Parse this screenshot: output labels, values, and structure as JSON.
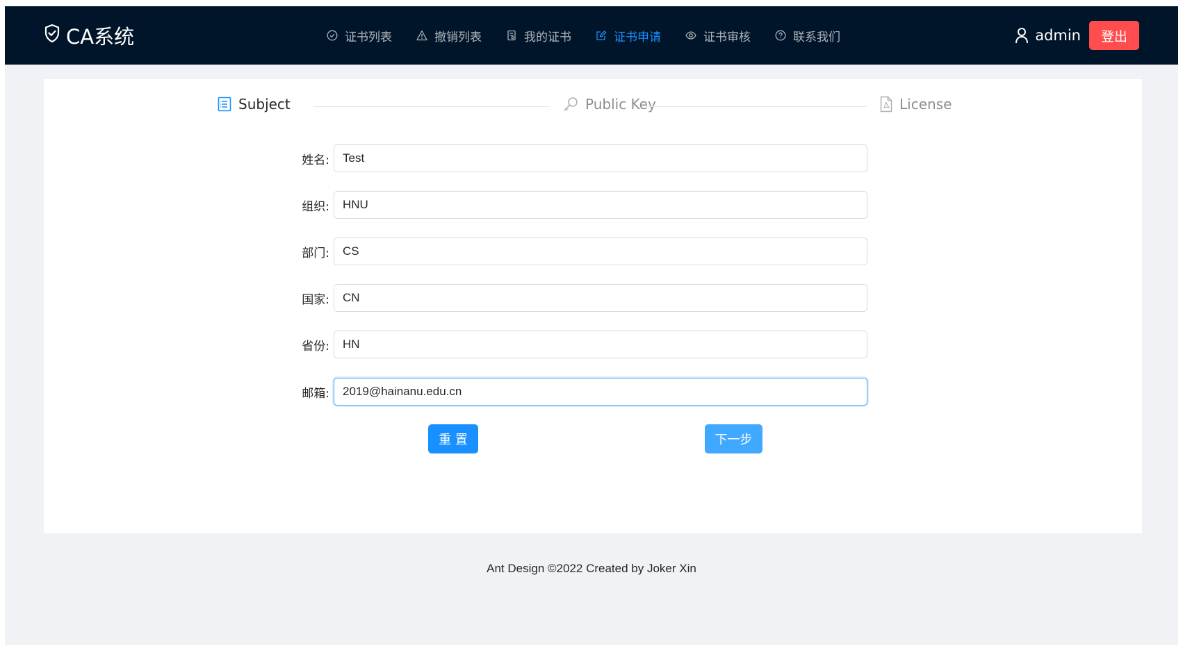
{
  "header": {
    "logo_text": "CA系统",
    "nav": [
      {
        "label": "证书列表",
        "icon": "check-circle-icon",
        "active": false
      },
      {
        "label": "撤销列表",
        "icon": "warning-icon",
        "active": false
      },
      {
        "label": "我的证书",
        "icon": "file-icon",
        "active": false
      },
      {
        "label": "证书申请",
        "icon": "edit-icon",
        "active": true
      },
      {
        "label": "证书审核",
        "icon": "eye-icon",
        "active": false
      },
      {
        "label": "联系我们",
        "icon": "question-circle-icon",
        "active": false
      }
    ],
    "username": "admin",
    "logout_label": "登出"
  },
  "steps": [
    {
      "label": "Subject",
      "icon": "list-icon",
      "status": "active"
    },
    {
      "label": "Public Key",
      "icon": "key-icon",
      "status": "wait"
    },
    {
      "label": "License",
      "icon": "file-pdf-icon",
      "status": "wait"
    }
  ],
  "form": {
    "name": {
      "label": "姓名:",
      "value": "Test"
    },
    "org": {
      "label": "组织:",
      "value": "HNU"
    },
    "dept": {
      "label": "部门:",
      "value": "CS"
    },
    "country": {
      "label": "国家:",
      "value": "CN"
    },
    "province": {
      "label": "省份:",
      "value": "HN"
    },
    "email": {
      "label": "邮箱:",
      "value": "2019@hainanu.edu.cn"
    }
  },
  "buttons": {
    "reset_label": "重 置",
    "next_label": "下一步"
  },
  "footer": {
    "text": "Ant Design ©2022 Created by Joker Xin"
  },
  "colors": {
    "header_bg": "#001529",
    "primary": "#1890ff",
    "danger": "#ff4d4f",
    "page_bg": "#f0f2f5"
  }
}
